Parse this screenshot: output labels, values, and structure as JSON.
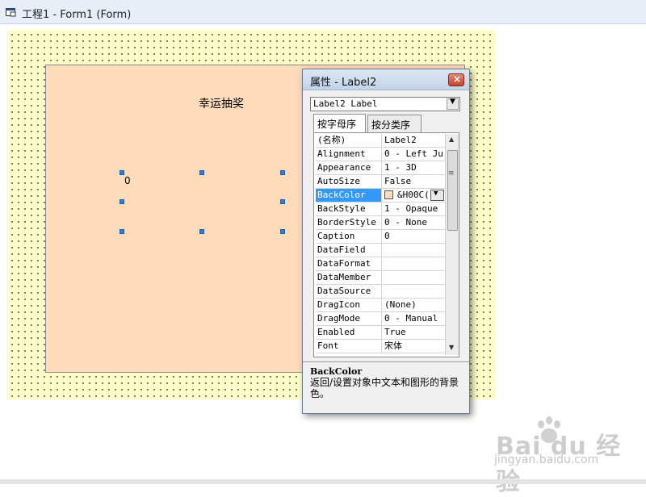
{
  "window": {
    "title": "工程1 - Form1 (Form)"
  },
  "form": {
    "title_label": "幸运抽奖",
    "value_label": "0",
    "frame_color": "#ffdcb9",
    "grid_color": "#ffffc8"
  },
  "properties": {
    "window_title": "属性 - Label2",
    "close_label": "×",
    "object_selector": "Label2 Label",
    "tabs": [
      {
        "label": "按字母序"
      },
      {
        "label": "按分类序"
      }
    ],
    "rows": [
      {
        "name": "(名称)",
        "value": "Label2"
      },
      {
        "name": "Alignment",
        "value": "0 - Left Ju"
      },
      {
        "name": "Appearance",
        "value": "1 - 3D"
      },
      {
        "name": "AutoSize",
        "value": "False"
      },
      {
        "name": "BackColor",
        "value": "&H00C("
      },
      {
        "name": "BackStyle",
        "value": "1 - Opaque"
      },
      {
        "name": "BorderStyle",
        "value": "0 - None"
      },
      {
        "name": "Caption",
        "value": "0"
      },
      {
        "name": "DataField",
        "value": ""
      },
      {
        "name": "DataFormat",
        "value": ""
      },
      {
        "name": "DataMember",
        "value": ""
      },
      {
        "name": "DataSource",
        "value": ""
      },
      {
        "name": "DragIcon",
        "value": "(None)"
      },
      {
        "name": "DragMode",
        "value": "0 - Manual"
      },
      {
        "name": "Enabled",
        "value": "True"
      },
      {
        "name": "Font",
        "value": "宋体"
      }
    ],
    "selected_property": "BackColor",
    "backcolor_swatch": "#ffdcb9",
    "description_title": "BackColor",
    "description_text": "返回/设置对象中文本和图形的背景色。"
  },
  "watermark": {
    "brand": "Bai du 经验",
    "url": "jingyan.baidu.com"
  }
}
